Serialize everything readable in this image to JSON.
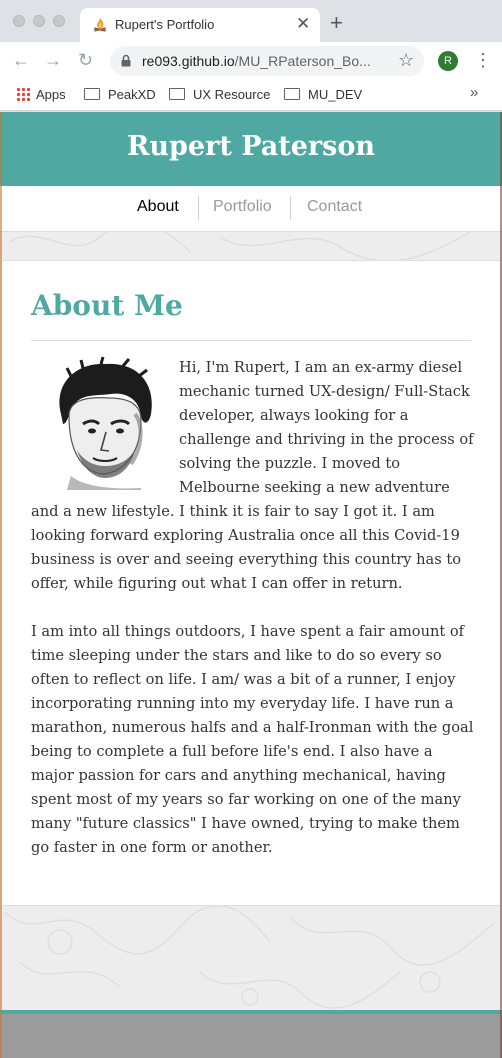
{
  "browser": {
    "tab": {
      "title": "Rupert's Portfolio",
      "favicon": "campfire-icon"
    },
    "new_tab_icon": "plus-icon",
    "url_host": "re093.github.io",
    "url_path": "/MU_RPaterson_Bo...",
    "profile_initial": "R",
    "bookmarks": [
      {
        "label": "Apps",
        "icon": "apps-grid-icon"
      },
      {
        "label": "PeakXD",
        "icon": "folder-icon"
      },
      {
        "label": "UX Resource",
        "icon": "folder-icon"
      },
      {
        "label": "MU_DEV",
        "icon": "folder-icon"
      }
    ],
    "more_bookmarks": "»"
  },
  "site": {
    "title": "Rupert Paterson",
    "accent_color": "#4fa9a2",
    "nav": [
      {
        "label": "About",
        "active": true
      },
      {
        "label": "Portfolio",
        "active": false
      },
      {
        "label": "Contact",
        "active": false
      }
    ],
    "about": {
      "heading": "About Me",
      "paragraph_1": "Hi, I'm Rupert, I am an ex-army diesel mechanic turned UX-design/ Full-Stack developer, always looking for a challenge and thriving in the process of solving the puzzle. I moved to Melbourne seeking a new adventure and a new lifestyle. I think it is fair to say I got it. I am looking forward exploring Australia once all this Covid-19 business is over and seeing everything this country has to offer, while figuring out what I can offer in return.",
      "paragraph_2": "I am into all things outdoors, I have spent a fair amount of time sleeping under the stars and like to do so every so often to reflect on life. I am/ was a bit of a runner, I enjoy incorporating running into my everyday life. I have run a marathon, numerous halfs and a half-Ironman with the goal being to complete a full before life's end. I also have a major passion for cars and anything mechanical, having spent most of my years so far working on one of the many many \"future classics\" I have owned, trying to make them go faster in one form or another."
    }
  }
}
